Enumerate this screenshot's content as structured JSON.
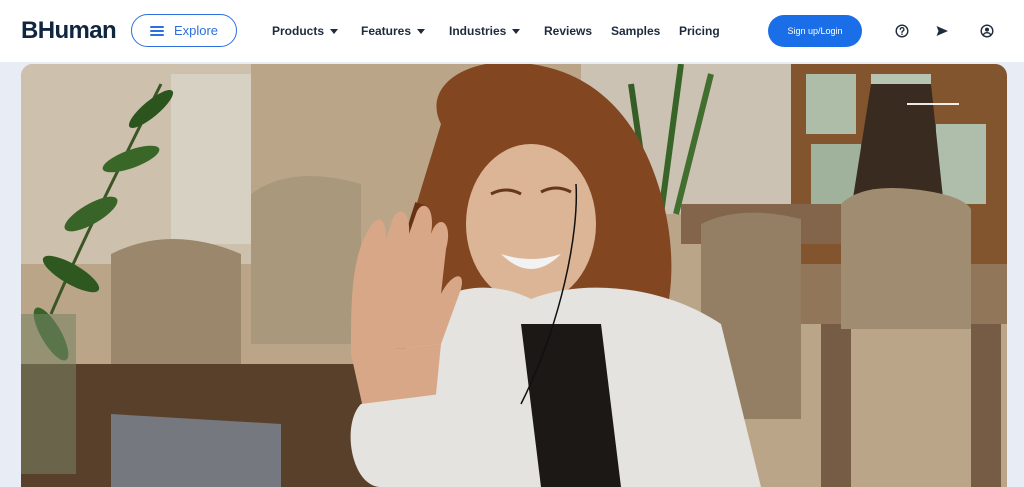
{
  "brand": {
    "logo_text": "BHuman"
  },
  "header": {
    "explore_label": "Explore",
    "nav": [
      {
        "label": "Products",
        "has_dropdown": true
      },
      {
        "label": "Features",
        "has_dropdown": true
      },
      {
        "label": "Industries",
        "has_dropdown": true
      },
      {
        "label": "Reviews",
        "has_dropdown": false
      },
      {
        "label": "Samples",
        "has_dropdown": false
      },
      {
        "label": "Pricing",
        "has_dropdown": false
      }
    ],
    "signup_label": "Sign up/Login",
    "icons": [
      "help-circle-icon",
      "send-icon",
      "user-circle-icon"
    ]
  },
  "hero": {
    "image_description_icon": "photo-woman-waving-icon"
  },
  "colors": {
    "accent": "#1a6fe8",
    "logo": "#0f2540",
    "nav_text": "#1e2b3c"
  }
}
